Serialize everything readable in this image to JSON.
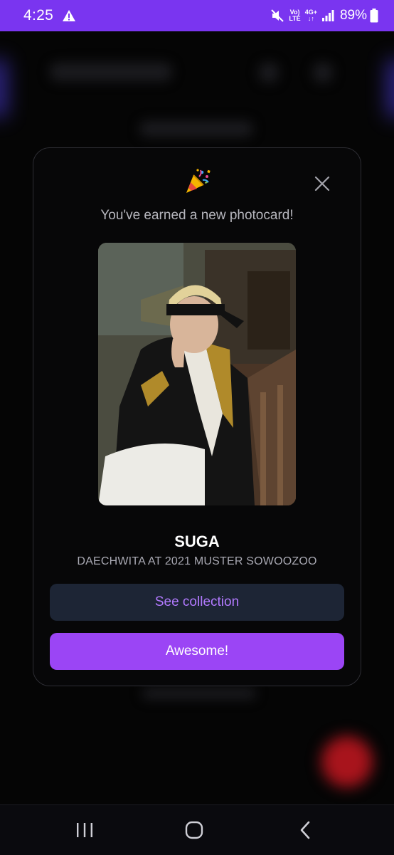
{
  "status_bar": {
    "time": "4:25",
    "volte_top": "Vo)",
    "volte_bottom": "LTE",
    "network": "4G+",
    "battery_percent": "89%",
    "icons": [
      "warning-icon",
      "mute-icon",
      "signal-icon",
      "battery-icon"
    ]
  },
  "modal": {
    "emoji": "party-popper",
    "title": "You've earned a new photocard!",
    "card": {
      "name": "SUGA",
      "subtitle": "DAECHWITA AT 2021 MUSTER SOWOOZOO"
    },
    "buttons": {
      "collection": "See collection",
      "awesome": "Awesome!"
    }
  },
  "colors": {
    "accent": "#9b45f5",
    "statusbar": "#7a35f0",
    "secondary_button_bg": "#1d2535",
    "secondary_button_text": "#b27aff"
  },
  "nav_bar": {
    "icons": [
      "recents-icon",
      "home-icon",
      "back-icon"
    ]
  }
}
